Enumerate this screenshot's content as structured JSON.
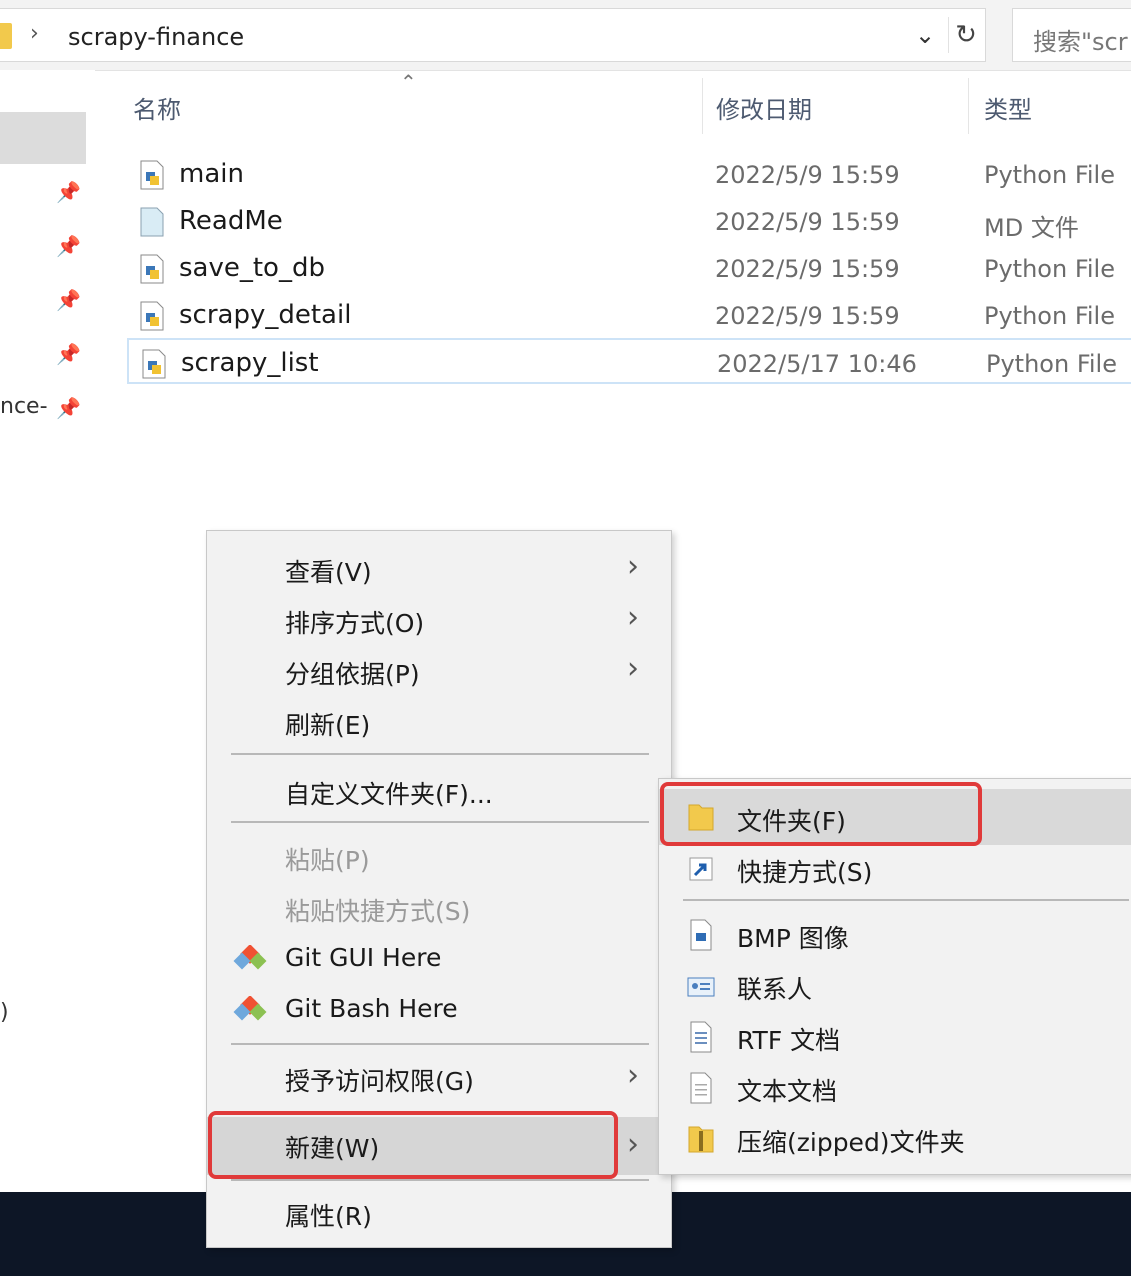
{
  "address": {
    "path": "scrapy-finance",
    "search_placeholder": "搜索\"scr"
  },
  "nav": {
    "label_partial": "nce-",
    "label_partial2": ")"
  },
  "columns": {
    "name": "名称",
    "date": "修改日期",
    "type": "类型"
  },
  "files": [
    {
      "name": "main",
      "date": "2022/5/9 15:59",
      "type": "Python File",
      "icon": "python-file-icon"
    },
    {
      "name": "ReadMe",
      "date": "2022/5/9 15:59",
      "type": "MD 文件",
      "icon": "md-file-icon"
    },
    {
      "name": "save_to_db",
      "date": "2022/5/9 15:59",
      "type": "Python File",
      "icon": "python-file-icon"
    },
    {
      "name": "scrapy_detail",
      "date": "2022/5/9 15:59",
      "type": "Python File",
      "icon": "python-file-icon"
    },
    {
      "name": "scrapy_list",
      "date": "2022/5/17 10:46",
      "type": "Python File",
      "icon": "python-file-icon"
    }
  ],
  "context_menu": {
    "view": "查看(V)",
    "sort": "排序方式(O)",
    "group": "分组依据(P)",
    "refresh": "刷新(E)",
    "customize": "自定义文件夹(F)...",
    "paste": "粘贴(P)",
    "paste_shortcut": "粘贴快捷方式(S)",
    "git_gui": "Git GUI Here",
    "git_bash": "Git Bash Here",
    "grant_access": "授予访问权限(G)",
    "new": "新建(W)",
    "properties": "属性(R)"
  },
  "submenu": {
    "folder": "文件夹(F)",
    "shortcut": "快捷方式(S)",
    "bmp": "BMP 图像",
    "contact": "联系人",
    "rtf": "RTF 文档",
    "text": "文本文档",
    "zip": "压缩(zipped)文件夹"
  },
  "colors": {
    "highlight_box": "#e03a3a",
    "menu_bg": "#f2f2f2",
    "folder_yellow": "#f2c94c"
  }
}
